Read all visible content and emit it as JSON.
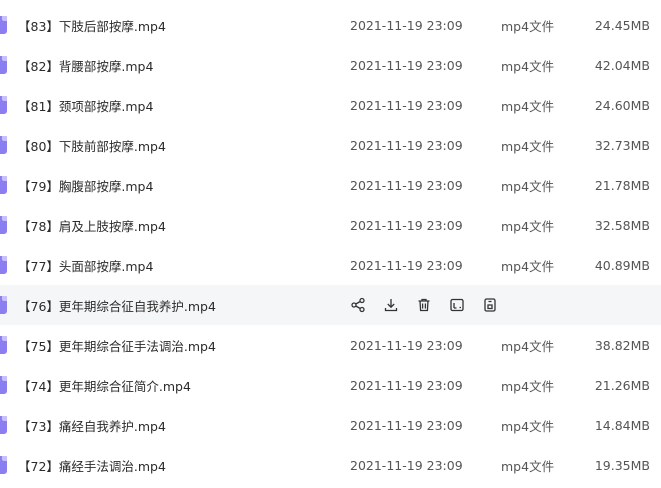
{
  "files": [
    {
      "name": "【83】下肢后部按摩.mp4",
      "date": "2021-11-19 23:09",
      "type": "mp4文件",
      "size": "24.45MB",
      "hover": false
    },
    {
      "name": "【82】背腰部按摩.mp4",
      "date": "2021-11-19 23:09",
      "type": "mp4文件",
      "size": "42.04MB",
      "hover": false
    },
    {
      "name": "【81】颈项部按摩.mp4",
      "date": "2021-11-19 23:09",
      "type": "mp4文件",
      "size": "24.60MB",
      "hover": false
    },
    {
      "name": "【80】下肢前部按摩.mp4",
      "date": "2021-11-19 23:09",
      "type": "mp4文件",
      "size": "32.73MB",
      "hover": false
    },
    {
      "name": "【79】胸腹部按摩.mp4",
      "date": "2021-11-19 23:09",
      "type": "mp4文件",
      "size": "21.78MB",
      "hover": false
    },
    {
      "name": "【78】肩及上肢按摩.mp4",
      "date": "2021-11-19 23:09",
      "type": "mp4文件",
      "size": "32.58MB",
      "hover": false
    },
    {
      "name": "【77】头面部按摩.mp4",
      "date": "2021-11-19 23:09",
      "type": "mp4文件",
      "size": "40.89MB",
      "hover": false
    },
    {
      "name": "【76】更年期综合征自我养护.mp4",
      "date": "",
      "type": "",
      "size": "",
      "hover": true
    },
    {
      "name": "【75】更年期综合征手法调治.mp4",
      "date": "2021-11-19 23:09",
      "type": "mp4文件",
      "size": "38.82MB",
      "hover": false
    },
    {
      "name": "【74】更年期综合征简介.mp4",
      "date": "2021-11-19 23:09",
      "type": "mp4文件",
      "size": "21.26MB",
      "hover": false
    },
    {
      "name": "【73】痛经自我养护.mp4",
      "date": "2021-11-19 23:09",
      "type": "mp4文件",
      "size": "14.84MB",
      "hover": false
    },
    {
      "name": "【72】痛经手法调治.mp4",
      "date": "2021-11-19 23:09",
      "type": "mp4文件",
      "size": "19.35MB",
      "hover": false
    }
  ],
  "hover_actions": [
    "share-icon",
    "download-icon",
    "delete-icon",
    "rename-icon",
    "more-info-icon"
  ],
  "colors": {
    "file_icon": "#8b7ef0",
    "hover_row": "#f5f6f8",
    "text": "#2b2b2b",
    "meta_text": "#555555"
  }
}
